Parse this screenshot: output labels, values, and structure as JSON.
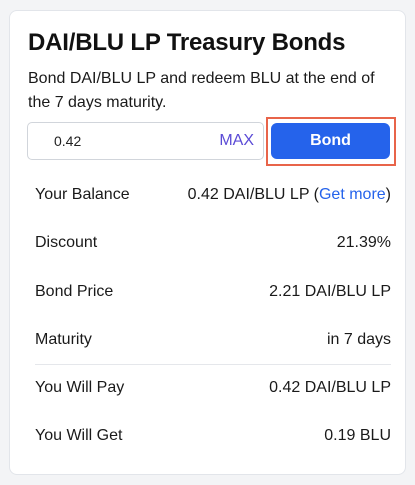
{
  "card": {
    "title": "DAI/BLU LP Treasury Bonds",
    "description": "Bond DAI/BLU LP and redeem BLU at the end of the 7 days maturity."
  },
  "form": {
    "amount_value": "0.42",
    "max_label": "MAX",
    "bond_label": "Bond"
  },
  "details": {
    "balance_label": "Your Balance",
    "balance_value": "0.42 DAI/BLU LP",
    "get_more_open": " (",
    "get_more_label": "Get more",
    "get_more_close": ")",
    "discount_label": "Discount",
    "discount_value": "21.39%",
    "bond_price_label": "Bond Price",
    "bond_price_value": "2.21 DAI/BLU LP",
    "maturity_label": "Maturity",
    "maturity_value": "in 7 days",
    "pay_label": "You Will Pay",
    "pay_value": "0.42 DAI/BLU LP",
    "get_label": "You Will Get",
    "get_value": "0.19 BLU"
  },
  "colors": {
    "accent": "#2563eb",
    "max": "#5b4bd6",
    "highlight": "#e8644a"
  }
}
